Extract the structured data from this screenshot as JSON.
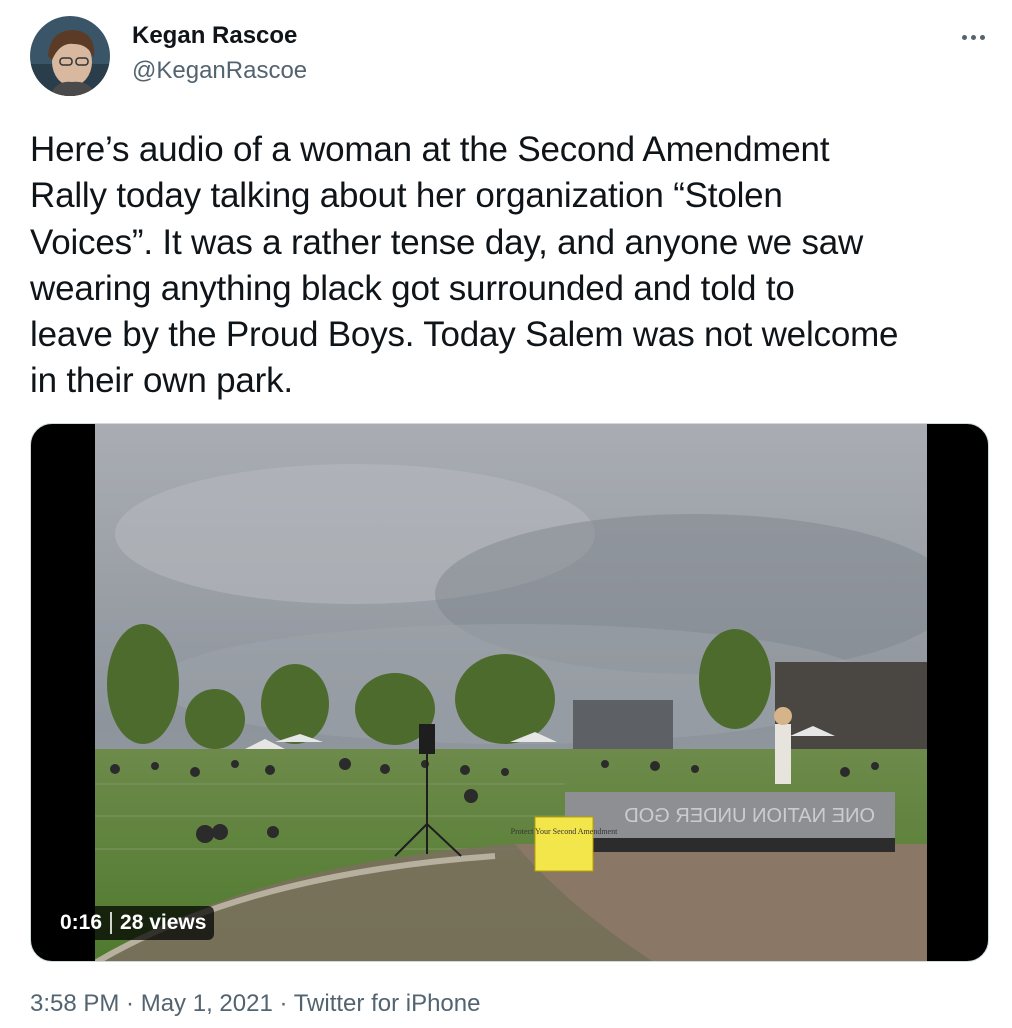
{
  "author": {
    "display_name": "Kegan Rascoe",
    "handle": "@KeganRascoe"
  },
  "tweet": {
    "text": "Here’s audio of a woman at the Second Amendment\nRally today talking about her organization “Stolen\nVoices”. It was a rather tense day, and anyone we saw\nwearing anything black got surrounded and told to\nleave by the Proud Boys. Today Salem was not welcome\nin their own park."
  },
  "media": {
    "duration": "0:16",
    "views": "28 views",
    "sign_text": "Protect Your Second Amendment",
    "stage_banner": "ONE NATION UNDER GOD"
  },
  "footer": {
    "time": "3:58 PM",
    "separator": " · ",
    "date": "May 1, 2021",
    "source": "Twitter for iPhone"
  },
  "colors": {
    "text_primary": "#0f1419",
    "text_secondary": "#536471",
    "media_border": "#cfd9de"
  },
  "icons": {
    "more": "ellipsis-icon"
  }
}
